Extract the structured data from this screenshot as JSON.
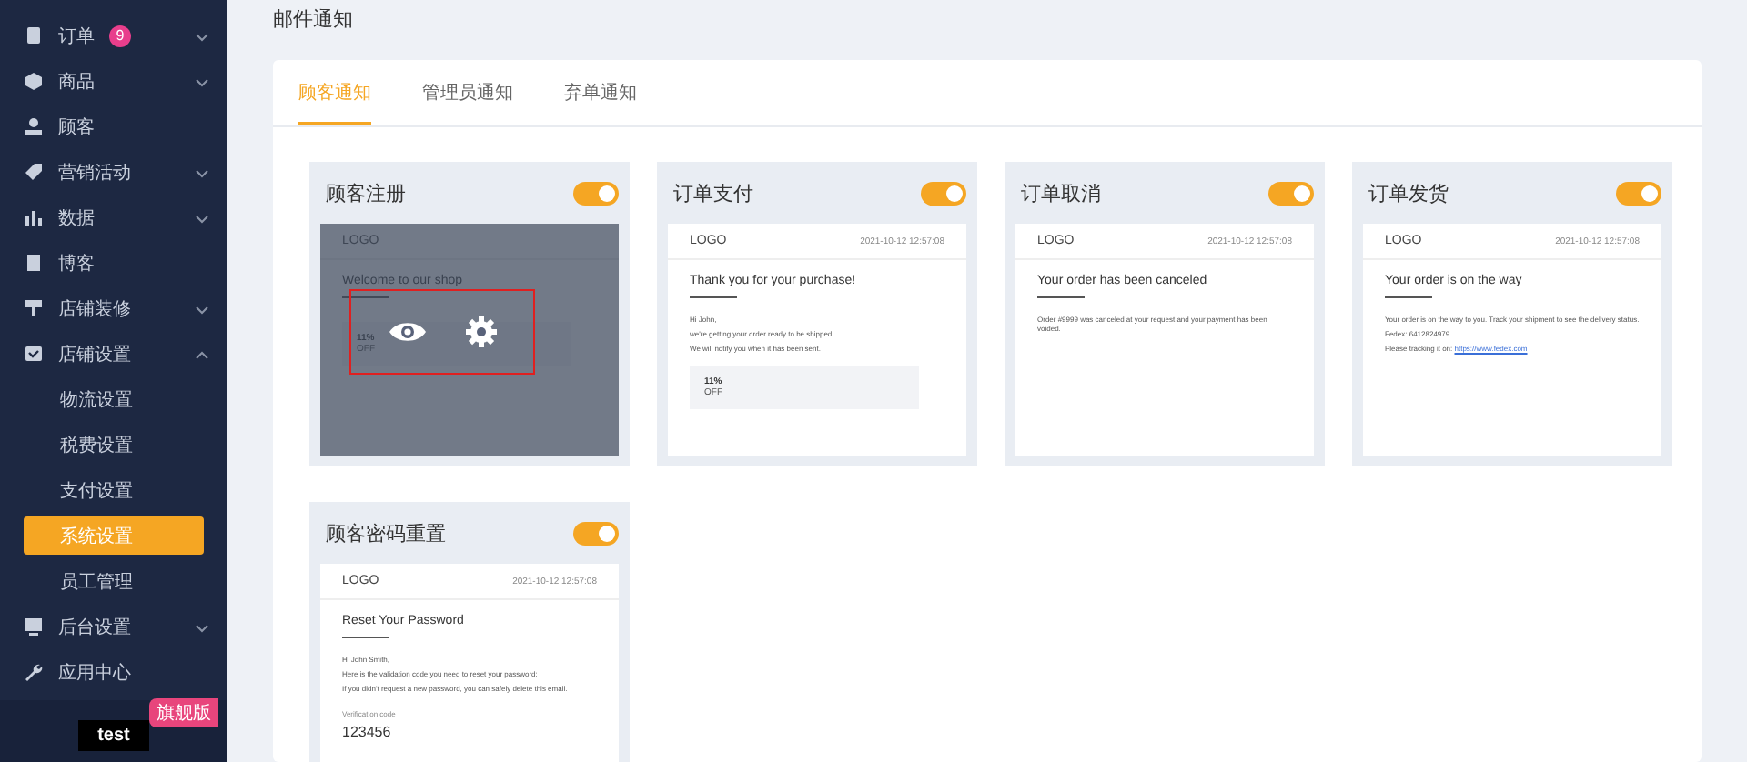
{
  "sidebar": {
    "items": [
      {
        "label": "订单",
        "kind": "group",
        "expanded": false,
        "badge": "9"
      },
      {
        "label": "商品",
        "kind": "group",
        "expanded": false
      },
      {
        "label": "顾客",
        "kind": "link"
      },
      {
        "label": "营销活动",
        "kind": "group",
        "expanded": false
      },
      {
        "label": "数据",
        "kind": "group",
        "expanded": false
      },
      {
        "label": "博客",
        "kind": "link"
      },
      {
        "label": "店铺装修",
        "kind": "group",
        "expanded": false
      },
      {
        "label": "店铺设置",
        "kind": "group",
        "expanded": true,
        "children": [
          {
            "label": "物流设置",
            "selected": false
          },
          {
            "label": "税费设置",
            "selected": false
          },
          {
            "label": "支付设置",
            "selected": false
          },
          {
            "label": "系统设置",
            "selected": true
          },
          {
            "label": "员工管理",
            "selected": false
          }
        ]
      },
      {
        "label": "后台设置",
        "kind": "group",
        "expanded": false
      },
      {
        "label": "应用中心",
        "kind": "link"
      }
    ],
    "user": "test",
    "plan_badge": "旗舰版"
  },
  "page_title": "邮件通知",
  "tabs": [
    {
      "label": "顾客通知",
      "selected": true
    },
    {
      "label": "管理员通知",
      "selected": false
    },
    {
      "label": "弃单通知",
      "selected": false
    }
  ],
  "cards": [
    {
      "title": "顾客注册",
      "on": true,
      "hovered": true,
      "email": {
        "logo": "LOGO",
        "heading": "Welcome to our shop",
        "blocks": [
          {
            "kind": "coupon",
            "percent": "11%",
            "off": "OFF"
          }
        ]
      }
    },
    {
      "title": "订单支付",
      "on": true,
      "hovered": false,
      "email": {
        "logo": "LOGO",
        "date": "2021-10-12 12:57:08",
        "heading": "Thank you for your purchase!",
        "blocks": [
          {
            "kind": "text",
            "text": "Hi John,"
          },
          {
            "kind": "text",
            "text": "we're getting your order ready to be shipped."
          },
          {
            "kind": "text",
            "text": "We will notify you when it has been sent."
          },
          {
            "kind": "coupon",
            "percent": "11%",
            "off": "OFF"
          }
        ]
      }
    },
    {
      "title": "订单取消",
      "on": true,
      "hovered": false,
      "email": {
        "logo": "LOGO",
        "date": "2021-10-12 12:57:08",
        "heading": "Your order has been canceled",
        "blocks": [
          {
            "kind": "text",
            "text": "Order #9999 was canceled at your request and your payment has been voided."
          }
        ]
      }
    },
    {
      "title": "订单发货",
      "on": true,
      "hovered": false,
      "email": {
        "logo": "LOGO",
        "date": "2021-10-12 12:57:08",
        "heading": "Your order is on the way",
        "blocks": [
          {
            "kind": "text",
            "text": "Your order is on the way to you. Track your shipment to see the delivery status."
          },
          {
            "kind": "text",
            "text": "Fedex:  6412824979"
          },
          {
            "kind": "link",
            "text": "Please tracking it on:",
            "link": "https://www.fedex.com"
          }
        ]
      }
    },
    {
      "title": "顾客密码重置",
      "on": true,
      "hovered": false,
      "email": {
        "logo": "LOGO",
        "date": "2021-10-12 12:57:08",
        "heading": "Reset Your Password",
        "blocks": [
          {
            "kind": "text",
            "text": "Hi John Smith,"
          },
          {
            "kind": "text",
            "text": "Here is the validation code you need to reset your password:"
          },
          {
            "kind": "text",
            "text": "If you didn't request a new password, you can safely delete this email."
          },
          {
            "kind": "code",
            "label": "Verification code",
            "code": "123456"
          }
        ]
      }
    }
  ]
}
